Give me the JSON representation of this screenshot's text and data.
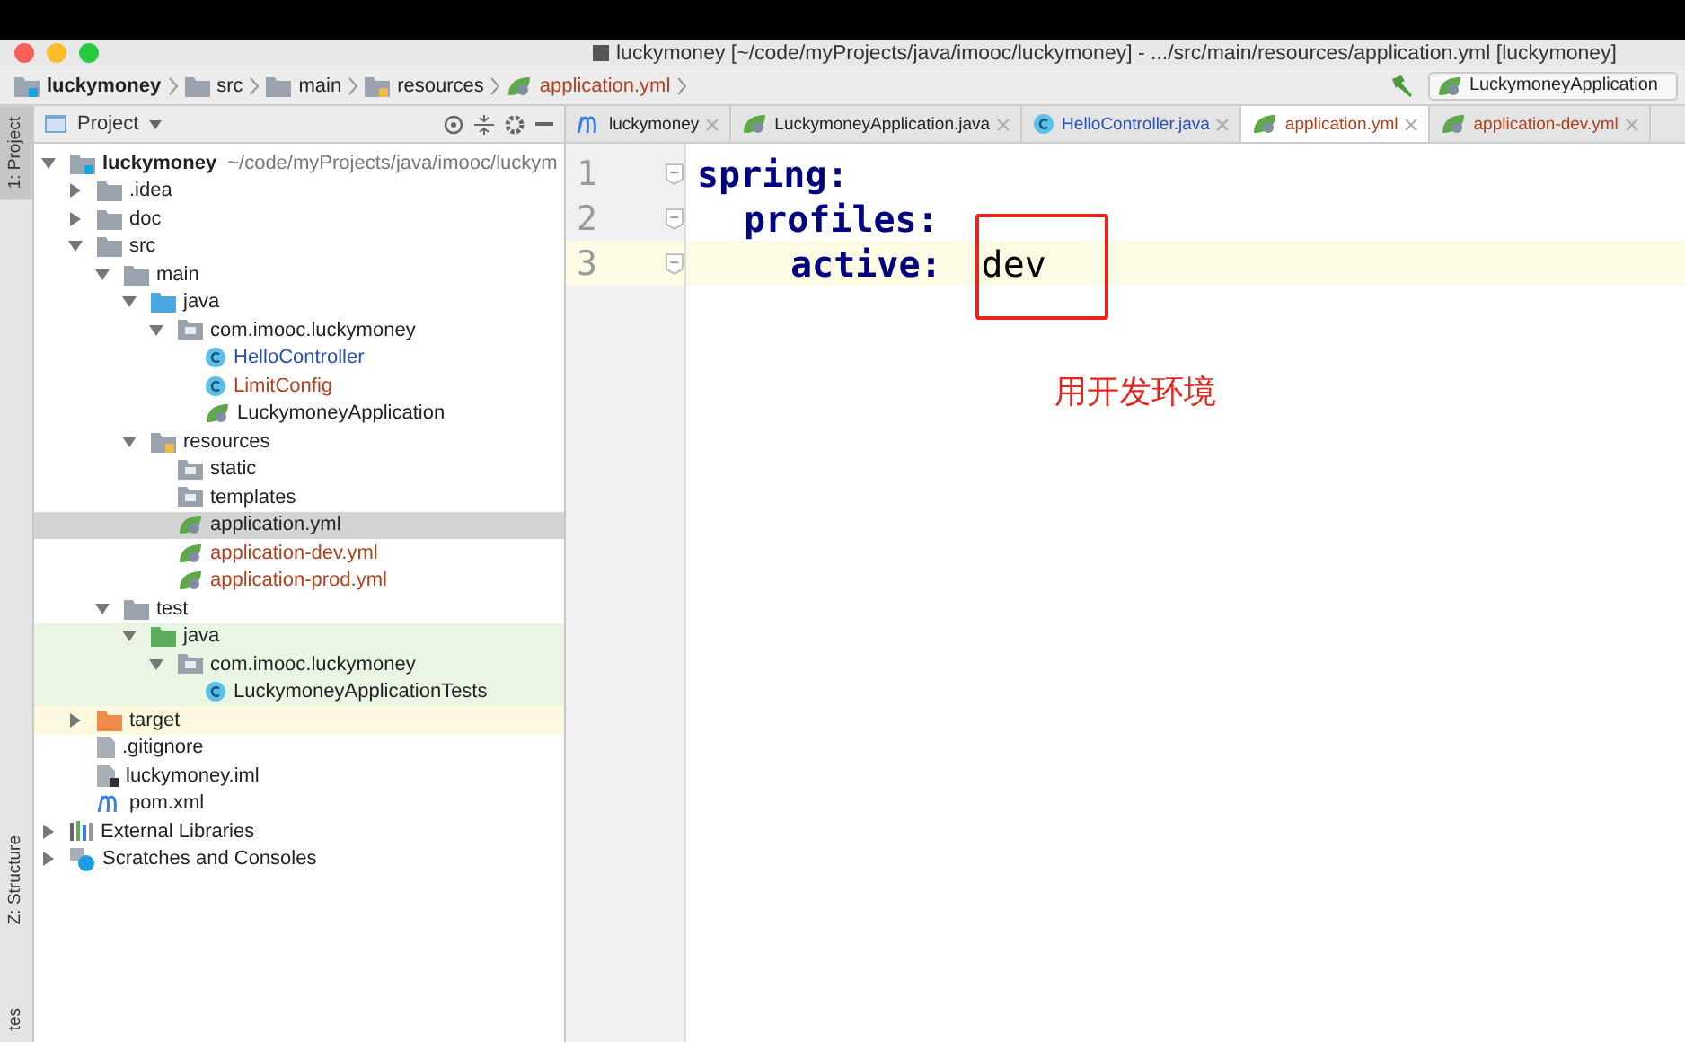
{
  "window": {
    "title": "luckymoney [~/code/myProjects/java/imooc/luckymoney] - .../src/main/resources/application.yml [luckymoney]"
  },
  "breadcrumb": [
    {
      "label": "luckymoney",
      "kind": "module"
    },
    {
      "label": "src",
      "kind": "folder"
    },
    {
      "label": "main",
      "kind": "folder"
    },
    {
      "label": "resources",
      "kind": "resources"
    },
    {
      "label": "application.yml",
      "kind": "yml"
    }
  ],
  "run_config": {
    "label": "LuckymoneyApplication"
  },
  "side_tabs": [
    {
      "label": "1: Project",
      "selected": true
    },
    {
      "label": "Z: Structure",
      "selected": false
    },
    {
      "label": "tes",
      "selected": false
    }
  ],
  "project_panel": {
    "title": "Project"
  },
  "tree": [
    {
      "label": "luckymoney",
      "path": "~/code/myProjects/java/imooc/luckym",
      "kind": "module",
      "expanded": true,
      "selected": false,
      "modified": false,
      "unversioned": false,
      "test_source": false,
      "excluded": false,
      "children": [
        {
          "label": ".idea",
          "kind": "folder",
          "expanded": false,
          "selected": false,
          "modified": false,
          "unversioned": false,
          "test_source": false,
          "excluded": false
        },
        {
          "label": "doc",
          "kind": "folder",
          "expanded": false,
          "selected": false,
          "modified": false,
          "unversioned": false,
          "test_source": false,
          "excluded": false
        },
        {
          "label": "src",
          "kind": "folder",
          "expanded": true,
          "selected": false,
          "modified": false,
          "unversioned": false,
          "test_source": false,
          "excluded": false,
          "children": [
            {
              "label": "main",
              "kind": "folder",
              "expanded": true,
              "selected": false,
              "modified": false,
              "unversioned": false,
              "test_source": false,
              "excluded": false,
              "children": [
                {
                  "label": "java",
                  "kind": "source",
                  "expanded": true,
                  "selected": false,
                  "modified": false,
                  "unversioned": false,
                  "test_source": false,
                  "excluded": false,
                  "children": [
                    {
                      "label": "com.imooc.luckymoney",
                      "kind": "package",
                      "expanded": true,
                      "selected": false,
                      "modified": false,
                      "unversioned": false,
                      "test_source": false,
                      "excluded": false,
                      "children": [
                        {
                          "label": "HelloController",
                          "kind": "class",
                          "selected": false,
                          "modified": true,
                          "unversioned": false,
                          "test_source": false,
                          "excluded": false
                        },
                        {
                          "label": "LimitConfig",
                          "kind": "class",
                          "selected": false,
                          "modified": false,
                          "unversioned": true,
                          "test_source": false,
                          "excluded": false
                        },
                        {
                          "label": "LuckymoneyApplication",
                          "kind": "spring",
                          "selected": false,
                          "modified": false,
                          "unversioned": false,
                          "test_source": false,
                          "excluded": false
                        }
                      ]
                    }
                  ]
                },
                {
                  "label": "resources",
                  "kind": "resources",
                  "expanded": true,
                  "selected": false,
                  "modified": false,
                  "unversioned": false,
                  "test_source": false,
                  "excluded": false,
                  "children": [
                    {
                      "label": "static",
                      "kind": "package",
                      "selected": false,
                      "modified": false,
                      "unversioned": false,
                      "test_source": false,
                      "excluded": false
                    },
                    {
                      "label": "templates",
                      "kind": "package",
                      "selected": false,
                      "modified": false,
                      "unversioned": false,
                      "test_source": false,
                      "excluded": false
                    },
                    {
                      "label": "application.yml",
                      "kind": "yml",
                      "selected": true,
                      "modified": false,
                      "unversioned": false,
                      "test_source": false,
                      "excluded": false
                    },
                    {
                      "label": "application-dev.yml",
                      "kind": "yml",
                      "selected": false,
                      "modified": false,
                      "unversioned": true,
                      "test_source": false,
                      "excluded": false
                    },
                    {
                      "label": "application-prod.yml",
                      "kind": "yml",
                      "selected": false,
                      "modified": false,
                      "unversioned": true,
                      "test_source": false,
                      "excluded": false
                    }
                  ]
                }
              ]
            },
            {
              "label": "test",
              "kind": "folder",
              "expanded": true,
              "selected": false,
              "modified": false,
              "unversioned": false,
              "test_source": false,
              "excluded": false,
              "children": [
                {
                  "label": "java",
                  "kind": "test",
                  "expanded": true,
                  "selected": false,
                  "modified": false,
                  "unversioned": false,
                  "test_source": true,
                  "excluded": false,
                  "children": [
                    {
                      "label": "com.imooc.luckymoney",
                      "kind": "package",
                      "expanded": true,
                      "selected": false,
                      "modified": false,
                      "unversioned": false,
                      "test_source": true,
                      "excluded": false,
                      "children": [
                        {
                          "label": "LuckymoneyApplicationTests",
                          "kind": "testclass",
                          "selected": false,
                          "modified": false,
                          "unversioned": false,
                          "test_source": true,
                          "excluded": false
                        }
                      ]
                    }
                  ]
                }
              ]
            }
          ]
        },
        {
          "label": "target",
          "kind": "excluded",
          "expanded": false,
          "selected": false,
          "modified": false,
          "unversioned": false,
          "test_source": false,
          "excluded": true
        },
        {
          "label": ".gitignore",
          "kind": "file",
          "selected": false,
          "modified": false,
          "unversioned": false,
          "test_source": false,
          "excluded": false
        },
        {
          "label": "luckymoney.iml",
          "kind": "iml",
          "selected": false,
          "modified": false,
          "unversioned": false,
          "test_source": false,
          "excluded": false
        },
        {
          "label": "pom.xml",
          "kind": "maven",
          "selected": false,
          "modified": false,
          "unversioned": false,
          "test_source": false,
          "excluded": false
        }
      ]
    },
    {
      "label": "External Libraries",
      "kind": "libraries",
      "expanded": false,
      "selected": false,
      "modified": false,
      "unversioned": false,
      "test_source": false,
      "excluded": false
    },
    {
      "label": "Scratches and Consoles",
      "kind": "scratches",
      "expanded": false,
      "selected": false,
      "modified": false,
      "unversioned": false,
      "test_source": false,
      "excluded": false
    }
  ],
  "editor_tabs": [
    {
      "label": "luckymoney",
      "kind": "maven",
      "modified": false,
      "unversioned": false,
      "selected": false
    },
    {
      "label": "LuckymoneyApplication.java",
      "kind": "spring",
      "modified": false,
      "unversioned": false,
      "selected": false
    },
    {
      "label": "HelloController.java",
      "kind": "class",
      "modified": true,
      "unversioned": false,
      "selected": false
    },
    {
      "label": "application.yml",
      "kind": "yml",
      "modified": false,
      "unversioned": true,
      "selected": true
    },
    {
      "label": "application-dev.yml",
      "kind": "yml",
      "modified": false,
      "unversioned": true,
      "selected": false
    }
  ],
  "editor_lines": [
    {
      "number": "1",
      "key": "spring:",
      "current": false
    },
    {
      "number": "2",
      "key": "profiles:",
      "current": false
    },
    {
      "number": "3",
      "key": "active:",
      "value": "dev",
      "current": true
    }
  ],
  "annotation": {
    "text": "用开发环境"
  }
}
